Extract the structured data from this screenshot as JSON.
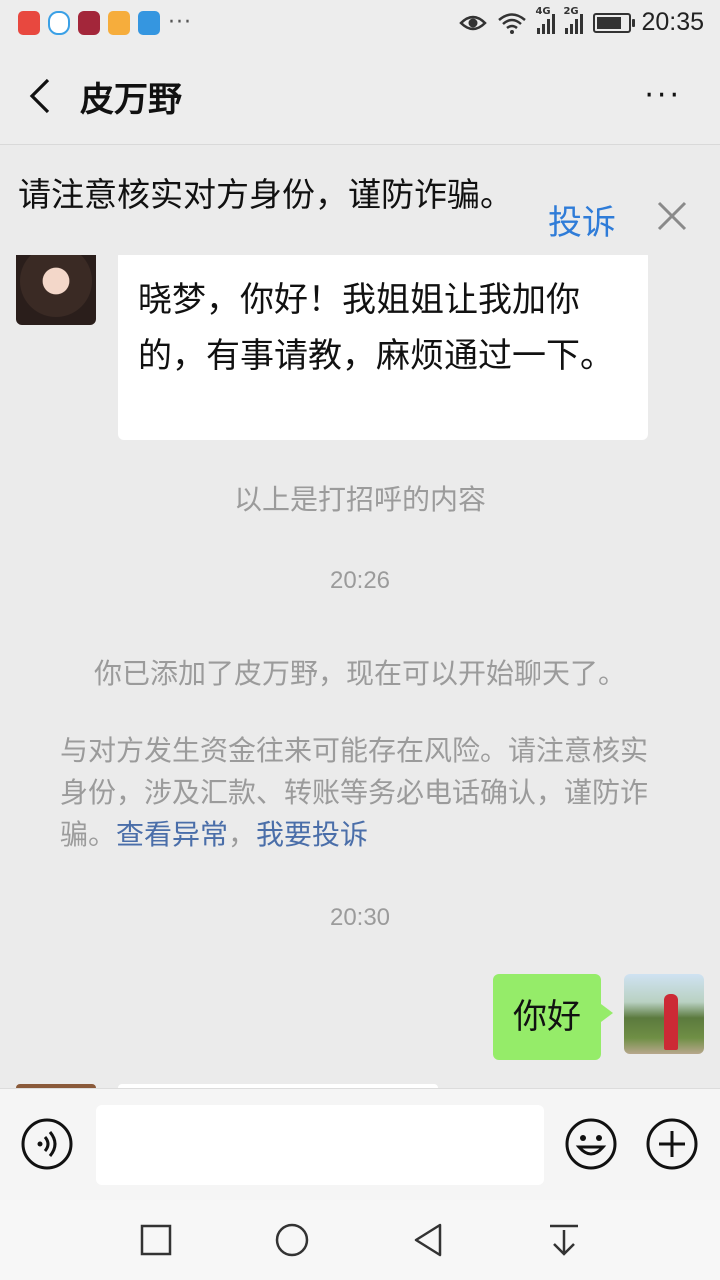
{
  "status_bar": {
    "time": "20:35",
    "network_1": "4G",
    "network_2": "2G",
    "more_dots": "···",
    "battery_level": 0.7,
    "app_icons": [
      "news-app-icon",
      "qq-icon",
      "music-app-icon",
      "video-app-icon",
      "wifi-tool-icon"
    ]
  },
  "header": {
    "title": "皮万野",
    "back_icon": "chevron-left-icon",
    "more_icon": "more-dots-icon",
    "more_label": "···"
  },
  "warning_banner": {
    "text": "请注意核实对方身份，谨防诈骗。",
    "report_label": "投诉",
    "close_icon": "close-icon"
  },
  "messages": {
    "greeting_text": "晓梦，你好！我姐姐让我加你的，有事请教，麻烦通过一下。",
    "greeting_caption": "以上是打招呼的内容",
    "time_1": "20:26",
    "added_notice": "你已添加了皮万野，现在可以开始聊天了。",
    "risk_notice": "与对方发生资金往来可能存在风险。请注意核实身份，涉及汇款、转账等务必电话确认，谨防诈骗。",
    "risk_link_1": "查看异常",
    "risk_sep": "，",
    "risk_link_2": "我要投诉",
    "time_2": "20:30",
    "my_message": "你好"
  },
  "input_bar": {
    "voice_icon": "voice-icon",
    "emoji_icon": "emoji-icon",
    "plus_icon": "plus-icon",
    "input_value": ""
  },
  "nav_bar": {
    "icons": [
      "recent-apps-icon",
      "home-icon",
      "back-icon",
      "notification-pull-icon"
    ]
  },
  "colors": {
    "accent_link": "#2f7cd8",
    "my_bubble": "#95ec69",
    "system_text": "#9b9b9b",
    "risk_link": "#4a6ea9"
  }
}
